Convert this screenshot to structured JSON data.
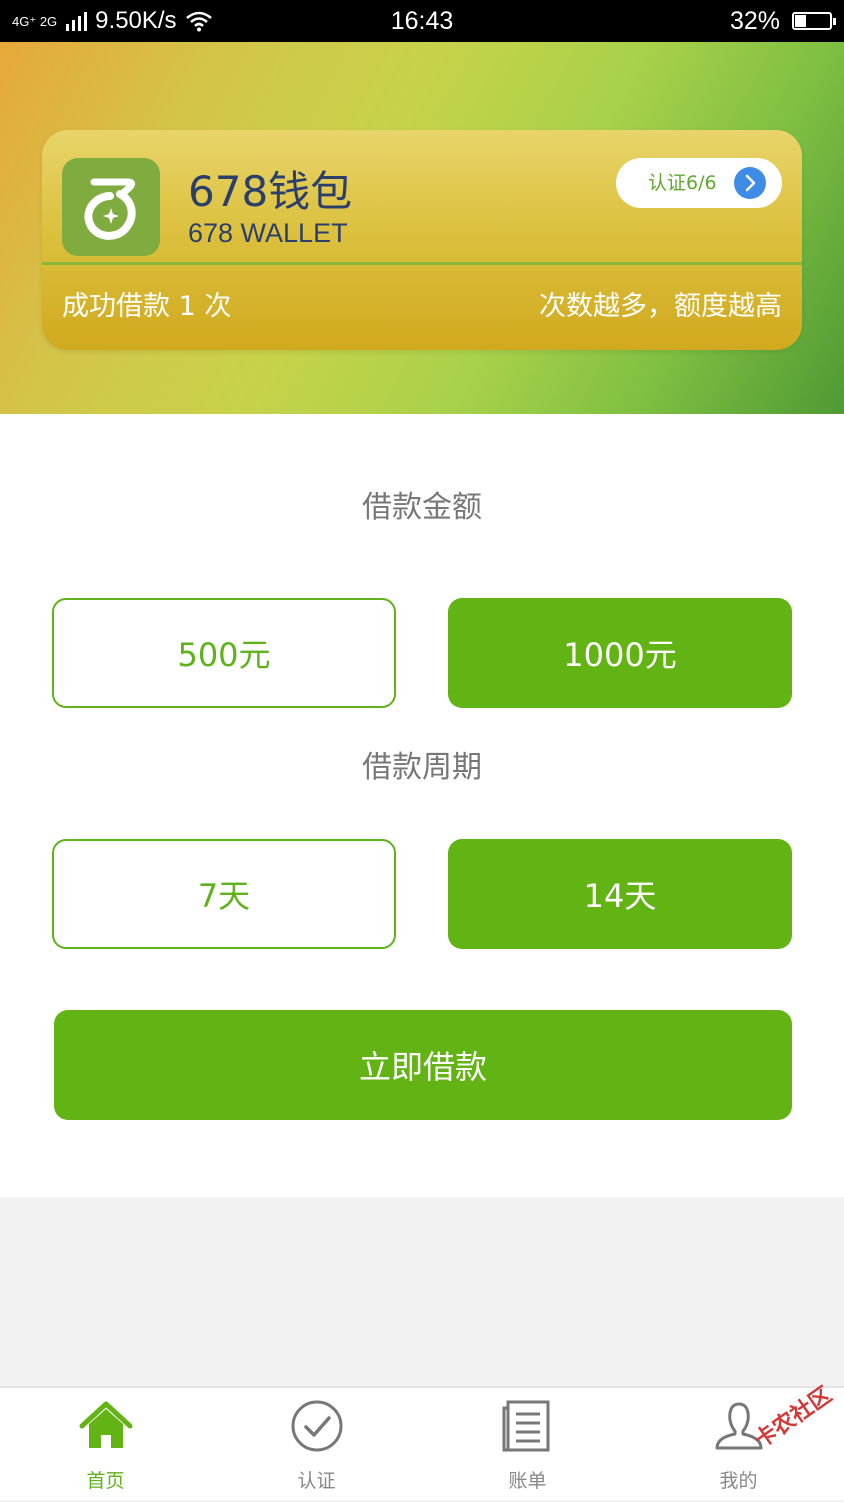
{
  "status_bar": {
    "network": "4G⁺ 2G",
    "speed": "9.50K/s",
    "time": "16:43",
    "battery_pct": "32%",
    "battery_level": 0.32
  },
  "card": {
    "brand_name": "678钱包",
    "brand_sub": "678 WALLET",
    "verify_label": "认证6/6",
    "loan_count": "成功借款 1 次",
    "slogan": "次数越多，额度越高"
  },
  "amount": {
    "title": "借款金额",
    "options": [
      "500元",
      "1000元"
    ],
    "selected_index": 1
  },
  "period": {
    "title": "借款周期",
    "options": [
      "7天",
      "14天"
    ],
    "selected_index": 1
  },
  "cta_label": "立即借款",
  "tabs": [
    {
      "label": "首页",
      "icon": "home-icon",
      "active": true
    },
    {
      "label": "认证",
      "icon": "check-circle-icon",
      "active": false
    },
    {
      "label": "账单",
      "icon": "bill-icon",
      "active": false
    },
    {
      "label": "我的",
      "icon": "user-icon",
      "active": false
    }
  ],
  "watermark": "卡农社区",
  "colors": {
    "primary_green": "#62b314",
    "brand_text": "#2c3f6b",
    "arrow_blue": "#3e8ce6"
  }
}
